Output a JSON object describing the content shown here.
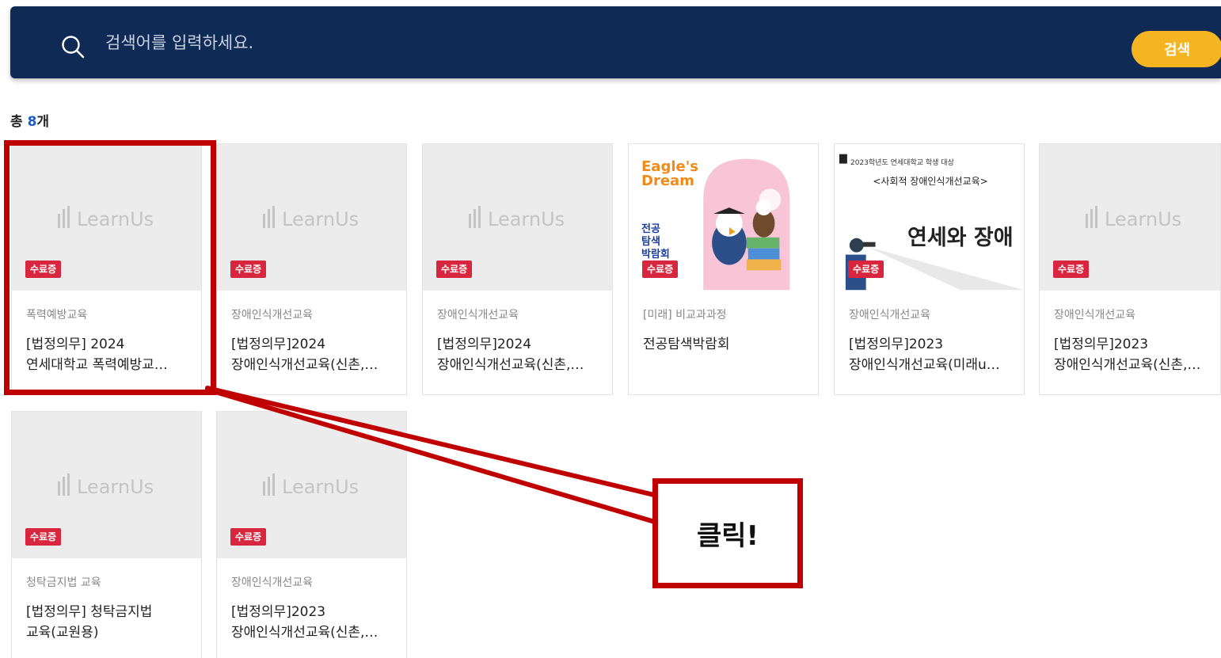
{
  "search": {
    "placeholder": "검색어를 입력하세요.",
    "button_label": "검색",
    "bar_color": "#0f2a55",
    "button_color": "#f5b523"
  },
  "results": {
    "prefix": "총 ",
    "count": "8",
    "suffix": "개"
  },
  "logo_text": "LearnUs",
  "badge_color": "#d7263d",
  "cards": [
    {
      "category": "폭력예방교육",
      "title_line1": "[법정의무] 2024",
      "title_line2": "연세대학교 폭력예방교…",
      "badge": "수료증",
      "thumbnail": "learnus-logo"
    },
    {
      "category": "장애인식개선교육",
      "title_line1": "[법정의무]2024",
      "title_line2": "장애인식개선교육(신촌,…",
      "badge": "수료증",
      "thumbnail": "learnus-logo"
    },
    {
      "category": "장애인식개선교육",
      "title_line1": "[법정의무]2024",
      "title_line2": "장애인식개선교육(신촌,…",
      "badge": "수료증",
      "thumbnail": "learnus-logo"
    },
    {
      "category": "[미래] 비교과과정",
      "title_line1": "전공탐색박람회",
      "title_line2": "",
      "badge": "수료증",
      "thumbnail": "eagles-dream-poster",
      "thumb_text": {
        "headline": "Eagle's Dream",
        "sub1": "전공",
        "sub2": "탐색",
        "sub3": "박람회"
      }
    },
    {
      "category": "장애인식개선교육",
      "title_line1": "[법정의무]2023",
      "title_line2": "장애인식개선교육(미래u…",
      "badge": "수료증",
      "thumbnail": "disability-poster",
      "thumb_text": {
        "line1": "2023학년도 연세대학교 학생 대상",
        "line2": "<사회적 장애인식개선교육>",
        "headline": "연세와 장애"
      }
    },
    {
      "category": "장애인식개선교육",
      "title_line1": "[법정의무]2023",
      "title_line2": "장애인식개선교육(신촌,…",
      "badge": "수료증",
      "thumbnail": "learnus-logo"
    },
    {
      "category": "청탁금지법 교육",
      "title_line1": "[법정의무] 청탁금지법",
      "title_line2": "교육(교원용)",
      "badge": "수료증",
      "thumbnail": "learnus-logo"
    },
    {
      "category": "장애인식개선교육",
      "title_line1": "[법정의무]2023",
      "title_line2": "장애인식개선교육(신촌,…",
      "badge": "수료증",
      "thumbnail": "learnus-logo"
    }
  ],
  "annotation": {
    "callout_text": "클릭!",
    "color": "#c00000"
  }
}
